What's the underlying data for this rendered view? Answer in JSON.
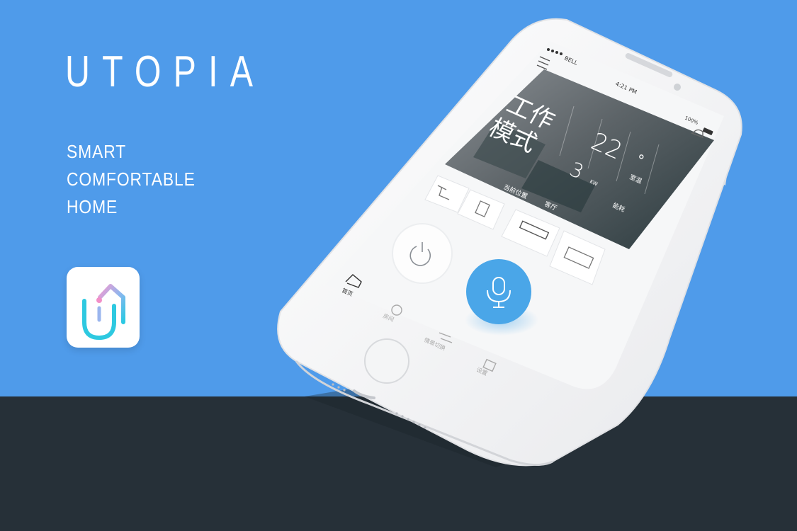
{
  "brand": {
    "title": "UTOPIA",
    "tagline": [
      "SMART",
      "COMFORTABLE",
      "HOME"
    ]
  },
  "colors": {
    "background": "#4f9bea",
    "floor": "#263038",
    "accent": "#4aa6e8",
    "icon_cyan": "#2ec9e0",
    "icon_pink": "#f28fc8"
  },
  "status_bar": {
    "carrier": "BELL",
    "time": "4:21 PM",
    "battery": "100%"
  },
  "hero": {
    "mode_line1": "工作",
    "mode_line2": "模式",
    "temperature": "22",
    "temperature_unit": "°",
    "power": "3",
    "power_unit": "KW",
    "room_temp_label": "室温",
    "location_label": "当前位置",
    "location_value": "客厅",
    "energy_label": "能耗"
  },
  "devices": [
    "lamp-icon",
    "speaker-icon",
    "air-conditioner-icon",
    "tv-icon"
  ],
  "tabs": [
    {
      "label": "首页",
      "icon": "home-icon"
    },
    {
      "label": "房间",
      "icon": "room-icon"
    },
    {
      "label": "情景切换",
      "icon": "scene-switch-icon"
    },
    {
      "label": "设置",
      "icon": "settings-icon"
    }
  ]
}
